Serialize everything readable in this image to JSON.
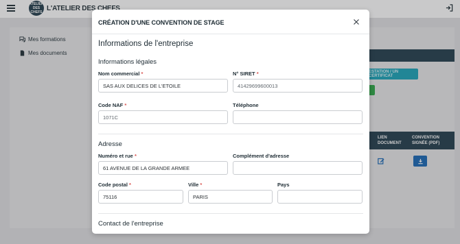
{
  "header": {
    "logo_text": "ATELIER DES CHEFS",
    "brand": "L'ATELIER DES CHEFS"
  },
  "sidebar": {
    "items": [
      {
        "label": "Mes formations",
        "icon": "chat-icon"
      },
      {
        "label": "Mes documents",
        "icon": "document-icon"
      }
    ]
  },
  "background": {
    "teal_button_label": "ESTATION / UN CERTIFICAT",
    "table_headers": [
      "LIEN DOCUMENT",
      "CONVENTION SIGNÉE (PDF)"
    ]
  },
  "modal": {
    "title": "CRÉATION D'UNE CONVENTION DE STAGE",
    "section": "Informations de l'entreprise",
    "legal": {
      "heading": "Informations légales",
      "nom_label": "Nom commercial",
      "nom_value": "SAS AUX DELICES DE L'ETOILE",
      "siret_label": "N° SIRET",
      "siret_value": "41429699600013",
      "naf_label": "Code NAF",
      "naf_value": "1071C",
      "tel_label": "Téléphone",
      "tel_value": ""
    },
    "address": {
      "heading": "Adresse",
      "rue_label": "Numéro et rue",
      "rue_value": "61 AVENUE DE LA GRANDE ARMEE",
      "complement_label": "Complément d'adresse",
      "complement_value": "",
      "cp_label": "Code postal",
      "cp_value": "75116",
      "ville_label": "Ville",
      "ville_value": "PARIS",
      "pays_label": "Pays",
      "pays_value": ""
    },
    "contact_heading": "Contact de l'entreprise",
    "required_mark": "*"
  },
  "colors": {
    "navy": "#1f3b4a",
    "teal": "#17a2b8",
    "green": "#2aa745",
    "blue": "#1566b5",
    "required": "#d9534f"
  }
}
